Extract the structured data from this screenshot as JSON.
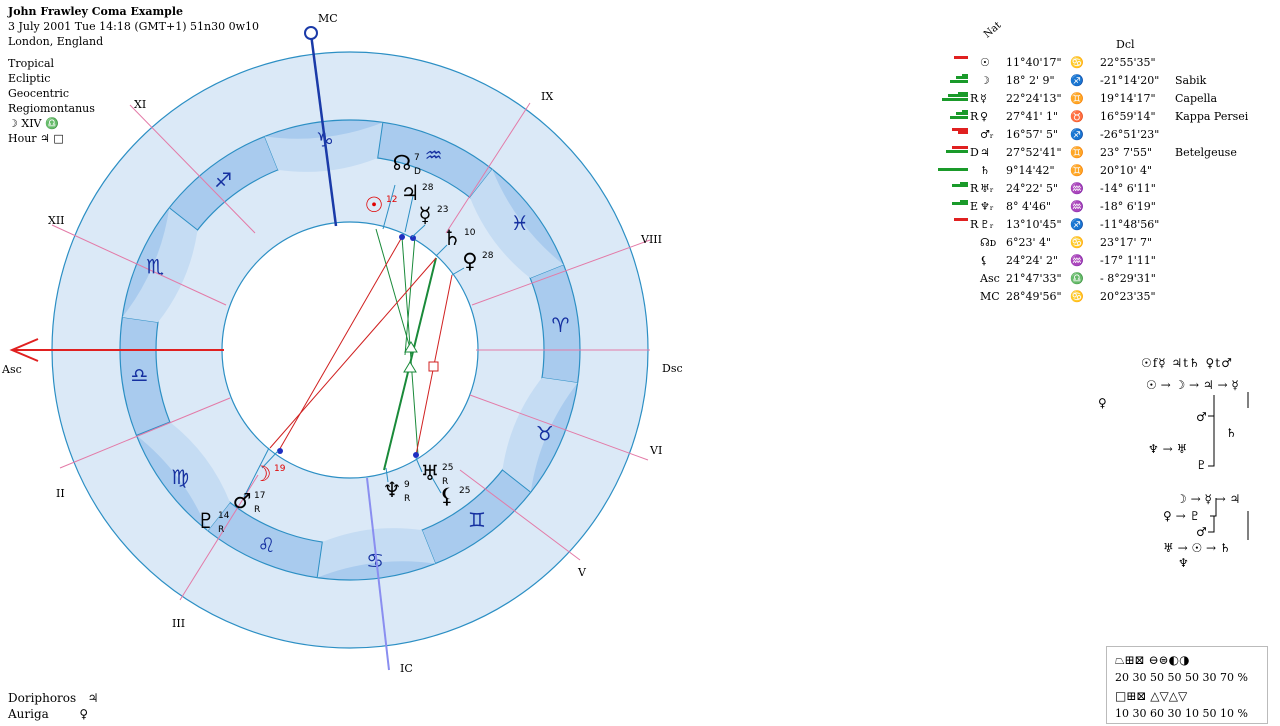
{
  "header": {
    "title": "John Frawley Coma Example",
    "date_line": "3 July 2001  Tue  14:18 (GMT+1) 51n30  0w10",
    "place": "London, England",
    "settings": [
      "Tropical",
      "Ecliptic",
      "Geocentric",
      "Regiomontanus"
    ],
    "moon_line": "☽  XIV  ♎",
    "hour_line": "Hour  ♃  □"
  },
  "bottom_left": [
    {
      "name": "Doriphoros",
      "glyph": "♃"
    },
    {
      "name": "Auriga",
      "glyph": "♀"
    }
  ],
  "wheel": {
    "angles": {
      "mc": "MC",
      "ic": "IC",
      "asc": "Asc",
      "dsc": "Dsc"
    },
    "houses": [
      "II",
      "III",
      "V",
      "VI",
      "VIII",
      "IX",
      "XI",
      "XII"
    ],
    "signs": [
      "♋",
      "♊",
      "♉",
      "♈",
      "♓",
      "♒",
      "♑",
      "♐",
      "♏",
      "♎",
      "♍",
      "♌"
    ],
    "planets": [
      {
        "glyph": "☊",
        "deg": "7",
        "sub": "D",
        "color": "#000000"
      },
      {
        "glyph": "♃",
        "deg": "28",
        "sub": "",
        "color": "#000000"
      },
      {
        "glyph": "☉",
        "deg": "12",
        "sub": "",
        "color": "#e00000"
      },
      {
        "glyph": "☿",
        "deg": "23",
        "sub": "",
        "color": "#000000"
      },
      {
        "glyph": "♄",
        "deg": "10",
        "sub": "",
        "color": "#000000"
      },
      {
        "glyph": "♀",
        "deg": "28",
        "sub": "",
        "color": "#000000"
      },
      {
        "glyph": "♅",
        "deg": "25",
        "sub": "R",
        "color": "#000000"
      },
      {
        "glyph": "⚸",
        "deg": "25",
        "sub": "",
        "color": "#000000"
      },
      {
        "glyph": "♆",
        "deg": "9",
        "sub": "R",
        "color": "#000000"
      },
      {
        "glyph": "☽",
        "deg": "19",
        "sub": "",
        "color": "#e00000"
      },
      {
        "glyph": "♂",
        "deg": "17",
        "sub": "R",
        "color": "#000000"
      },
      {
        "glyph": "♇",
        "deg": "14",
        "sub": "R",
        "color": "#000000"
      }
    ]
  },
  "table": {
    "col_nat": "Nat",
    "col_dcl": "Dcl",
    "rows": [
      {
        "flag": "",
        "glyph": "☉",
        "pos": "11°40'17\"",
        "sign": "♋",
        "dcl": "22°55'35\"",
        "star": "",
        "bars": "red1"
      },
      {
        "flag": "",
        "glyph": "☽",
        "pos": "18° 2' 9\"",
        "sign": "♐",
        "dcl": "-21°14'20\"",
        "star": "Sabik",
        "bars": "green3"
      },
      {
        "flag": "R",
        "glyph": "☿",
        "pos": "22°24'13\"",
        "sign": "♊",
        "dcl": "19°14'17\"",
        "star": "Capella",
        "bars": "green4"
      },
      {
        "flag": "R",
        "glyph": "♀",
        "pos": "27°41' 1\"",
        "sign": "♉",
        "dcl": "16°59'14\"",
        "star": "Kappa Persei",
        "bars": "green3"
      },
      {
        "flag": "",
        "glyph": "♂ᵣ",
        "pos": "16°57' 5\"",
        "sign": "♐",
        "dcl": "-26°51'23\"",
        "star": "",
        "bars": "red2"
      },
      {
        "flag": "D",
        "glyph": "♃",
        "pos": "27°52'41\"",
        "sign": "♊",
        "dcl": "23° 7'55\"",
        "star": "Betelgeuse",
        "bars": "mix"
      },
      {
        "flag": "",
        "glyph": "♄",
        "pos": "9°14'42\"",
        "sign": "♊",
        "dcl": "20°10' 4\"",
        "star": "",
        "bars": "green5"
      },
      {
        "flag": "R",
        "glyph": "♅ᵣ",
        "pos": "24°22' 5\"",
        "sign": "♒",
        "dcl": "-14° 6'11\"",
        "star": "",
        "bars": "green2"
      },
      {
        "flag": "E",
        "glyph": "♆ᵣ",
        "pos": "8° 4'46\"",
        "sign": "♒",
        "dcl": "-18° 6'19\"",
        "star": "",
        "bars": "green2"
      },
      {
        "flag": "R",
        "glyph": "♇ᵣ",
        "pos": "13°10'45\"",
        "sign": "♐",
        "dcl": "-11°48'56\"",
        "star": "",
        "bars": "red1"
      },
      {
        "flag": "",
        "glyph": "☊ᴅ",
        "pos": "6°23' 4\"",
        "sign": "♋",
        "dcl": "23°17' 7\"",
        "star": "",
        "bars": ""
      },
      {
        "flag": "",
        "glyph": "⚸",
        "pos": "24°24' 2\"",
        "sign": "♒",
        "dcl": "-17° 1'11\"",
        "star": "",
        "bars": ""
      },
      {
        "flag": "",
        "glyph": "Asc",
        "pos": "21°47'33\"",
        "sign": "♎",
        "dcl": "- 8°29'31\"",
        "star": "",
        "bars": ""
      },
      {
        "flag": "",
        "glyph": "MC",
        "pos": "28°49'56\"",
        "sign": "♋",
        "dcl": "20°23'35\"",
        "star": "",
        "bars": ""
      }
    ]
  },
  "receptions": {
    "top_row": "☉f☿ ♃t♄ ♀t♂",
    "chain1": "☉ → ☽ → ♃ → ☿",
    "venus_single": "♀",
    "mars1": "♂",
    "saturn1": "♄",
    "nep_ura": "♆ → ♅",
    "pluto1": "♇",
    "chain2": "☽ → ☿ → ♃",
    "venus_pluto": "♀ → ♇",
    "mars2": "♂",
    "chain3": "♅ → ☉ → ♄",
    "neptune2": "♆"
  },
  "legend": {
    "row1_symbols": "⏢⊞⊠  ⊖⊜◐◑",
    "row1_values": "20 30 50   50 50 30 70 %",
    "row2_symbols": "□⊞⊠  △▽△▽",
    "row2_values": "10 30 60   30 10 50 10 %"
  }
}
